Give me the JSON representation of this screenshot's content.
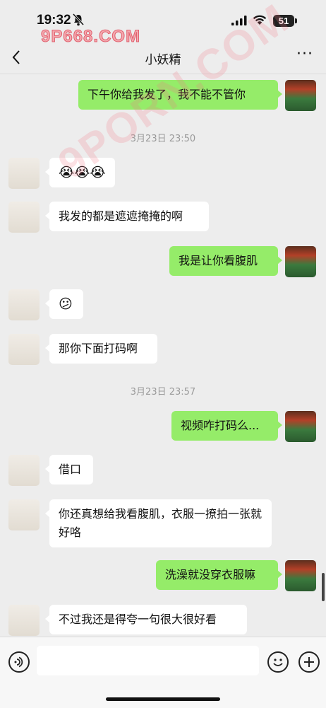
{
  "status_bar": {
    "time": "19:32",
    "battery": "51"
  },
  "watermark": {
    "top_text": "9P668.COM",
    "diagonal_text": "9PORN.COM"
  },
  "header": {
    "back": "<",
    "title": "小妖精",
    "more": "···"
  },
  "timestamps": [
    "3月23日 23:50",
    "3月23日 23:57"
  ],
  "messages": [
    {
      "from": "me",
      "text": "下午你给我发了，我不能不管你"
    },
    {
      "from": "them",
      "text": "😭😭😭"
    },
    {
      "from": "them",
      "text": "我发的都是遮遮掩掩的啊"
    },
    {
      "from": "me",
      "text": "我是让你看腹肌"
    },
    {
      "from": "them",
      "text": "😕"
    },
    {
      "from": "them",
      "text": "那你下面打码啊"
    },
    {
      "from": "me",
      "text": "视频咋打码么..."
    },
    {
      "from": "them",
      "text": "借口"
    },
    {
      "from": "them",
      "text": "你还真想给我看腹肌，衣服一撩拍一张就好咯"
    },
    {
      "from": "me",
      "text": "洗澡就没穿衣服嘛"
    },
    {
      "from": "them",
      "text": "不过我还是得夸一句很大很好看"
    }
  ],
  "colors": {
    "me_bubble": "#95ec69",
    "them_bubble": "#ffffff",
    "background": "#ededed"
  },
  "icons": [
    "mute-bell-icon",
    "signal-icon",
    "wifi-icon",
    "battery-icon",
    "back-icon",
    "more-icon",
    "voice-icon",
    "emoji-icon",
    "plus-icon"
  ]
}
